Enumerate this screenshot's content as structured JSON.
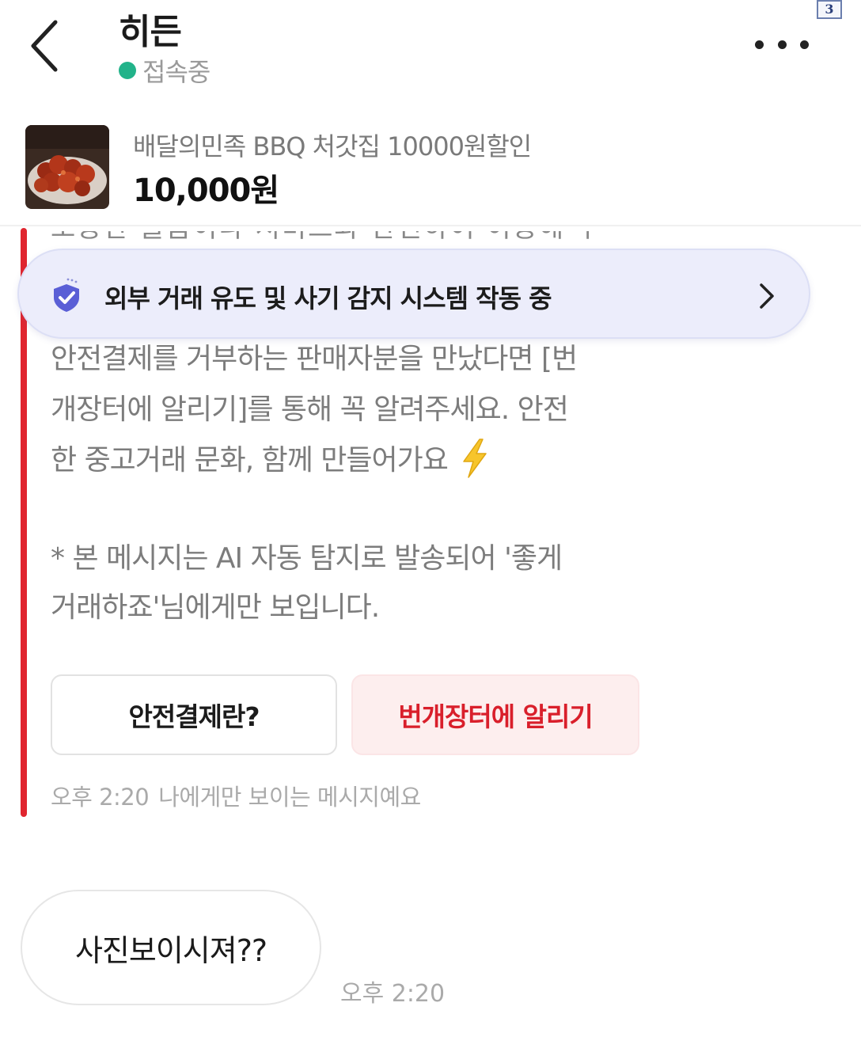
{
  "header": {
    "title": "히든",
    "status_text": "접속중",
    "status_color": "#22b38a",
    "corner_badge": "3"
  },
  "product": {
    "name": "배달의민족 BBQ 처갓집 10000원할인",
    "price": "10,000원"
  },
  "system_message": {
    "hidden_line": "소중한 물품이나 서비스와 관련하여 이용해 주세요",
    "alert_banner": "외부 거래 유도 및 사기 감지 시스템 작동 중",
    "lines": [
      "안전결제를 거부하는 판매자분을 만났다면 [번",
      "개장터에 알리기]를 통해 꼭 알려주세요. 안전",
      "한 중고거래 문화, 함께 만들어가요",
      "* 본 메시지는 AI 자동 탐지로 발송되어 '좋게",
      "거래하죠'님에게만 보입니다."
    ],
    "buttons": {
      "safe_pay": "안전결제란?",
      "report": "번개장터에 알리기"
    },
    "time": "오후 2:20",
    "visibility_note": "나에게만 보이는 메시지예요",
    "accent_color": "#e0262f"
  },
  "user_message": {
    "text": "사진보이시져??",
    "time": "오후 2:20"
  }
}
